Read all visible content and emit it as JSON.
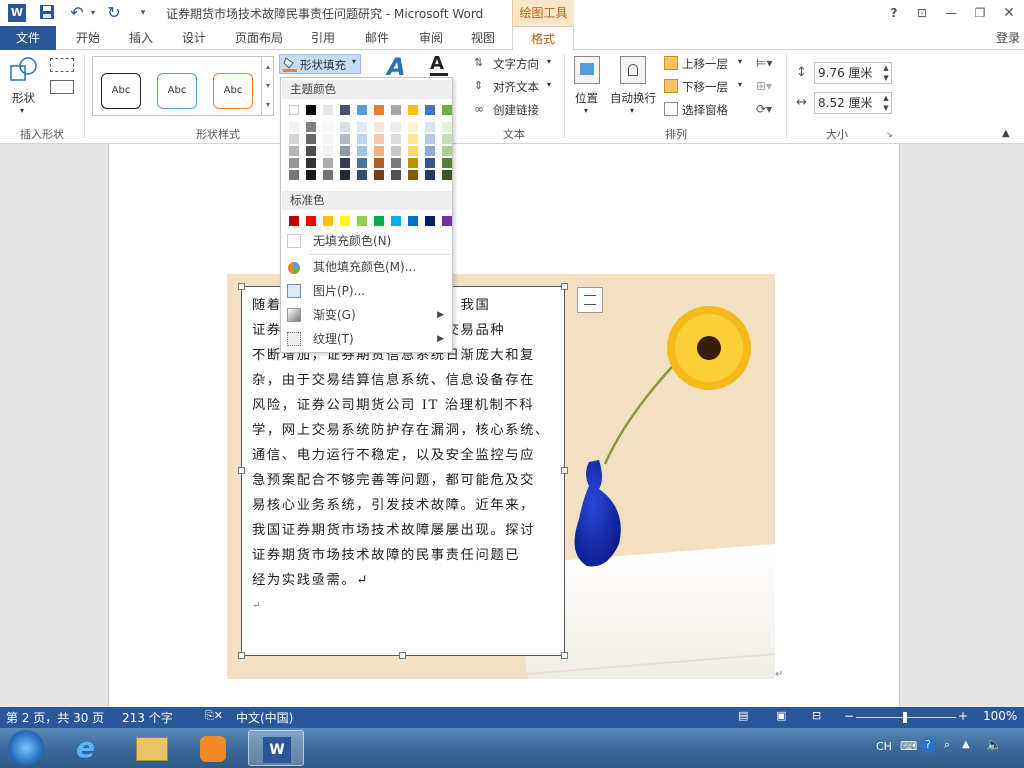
{
  "titlebar": {
    "title": "证券期货市场技术故障民事责任问题研究 - Microsoft Word",
    "context_tab": "绘图工具",
    "help": "?",
    "save_icon": "save-icon",
    "undo_icon": "undo-icon",
    "redo_icon": "redo-icon"
  },
  "tabs": {
    "file": "文件",
    "items": [
      "开始",
      "插入",
      "设计",
      "页面布局",
      "引用",
      "邮件",
      "审阅",
      "视图",
      "格式"
    ],
    "login": "登录"
  },
  "ribbon": {
    "insert_shapes": {
      "shapes_label": "形状",
      "group_label": "插入形状"
    },
    "shape_styles": {
      "samples": [
        "Abc",
        "Abc",
        "Abc"
      ],
      "fill_button": "形状填充",
      "group_label": "形状样式"
    },
    "text": {
      "direction": "文字方向",
      "align": "对齐文本",
      "link": "创建链接",
      "group_label": "文本"
    },
    "arrange": {
      "position": "位置",
      "wrap": "自动换行",
      "forward": "上移一层",
      "backward": "下移一层",
      "pane": "选择窗格",
      "group_label": "排列"
    },
    "size": {
      "height": "9.76 厘米",
      "width": "8.52 厘米",
      "group_label": "大小"
    }
  },
  "dropdown": {
    "theme_header": "主题颜色",
    "theme_top": [
      "#ffffff",
      "#000000",
      "#e7e6e6",
      "#44546a",
      "#5b9bd5",
      "#ed7d31",
      "#a5a5a5",
      "#ffc000",
      "#4472c4",
      "#70ad47"
    ],
    "standard_header": "标准色",
    "standard_colors": [
      "#c00000",
      "#ff0000",
      "#ffc000",
      "#ffff00",
      "#92d050",
      "#00b050",
      "#00b0f0",
      "#0070c0",
      "#002060",
      "#7030a0"
    ],
    "no_fill": "无填充颜色(N)",
    "more_colors": "其他填充颜色(M)...",
    "picture": "图片(P)...",
    "gradient": "渐变(G)",
    "texture": "纹理(T)"
  },
  "document": {
    "lines": [
      "随着证券期货业的发展和创新，我国",
      "证券期货市场规模快速增长，交易品种",
      "不断增加，证券期货信息系统日渐庞大和复",
      "杂，由于交易结算信息系统、信息设备存在",
      "风险，证券公司期货公司 IT 治理机制不科",
      "学，网上交易系统防护存在漏洞，核心系统、",
      "通信、电力运行不稳定，以及安全监控与应",
      "急预案配合不够完善等问题，都可能危及交",
      "易核心业务系统，引发技术故障。近年来，",
      "我国证券期货市场技术故障屡屡出现。探讨",
      "证券期货市场技术故障的民事责任问题已",
      "经为实践亟需。↵",
      "↵"
    ]
  },
  "statusbar": {
    "page": "第 2 页，共 30 页",
    "words": "213 个字",
    "language": "中文(中国)",
    "zoom": "100%"
  },
  "taskbar": {
    "ime": "CH"
  }
}
